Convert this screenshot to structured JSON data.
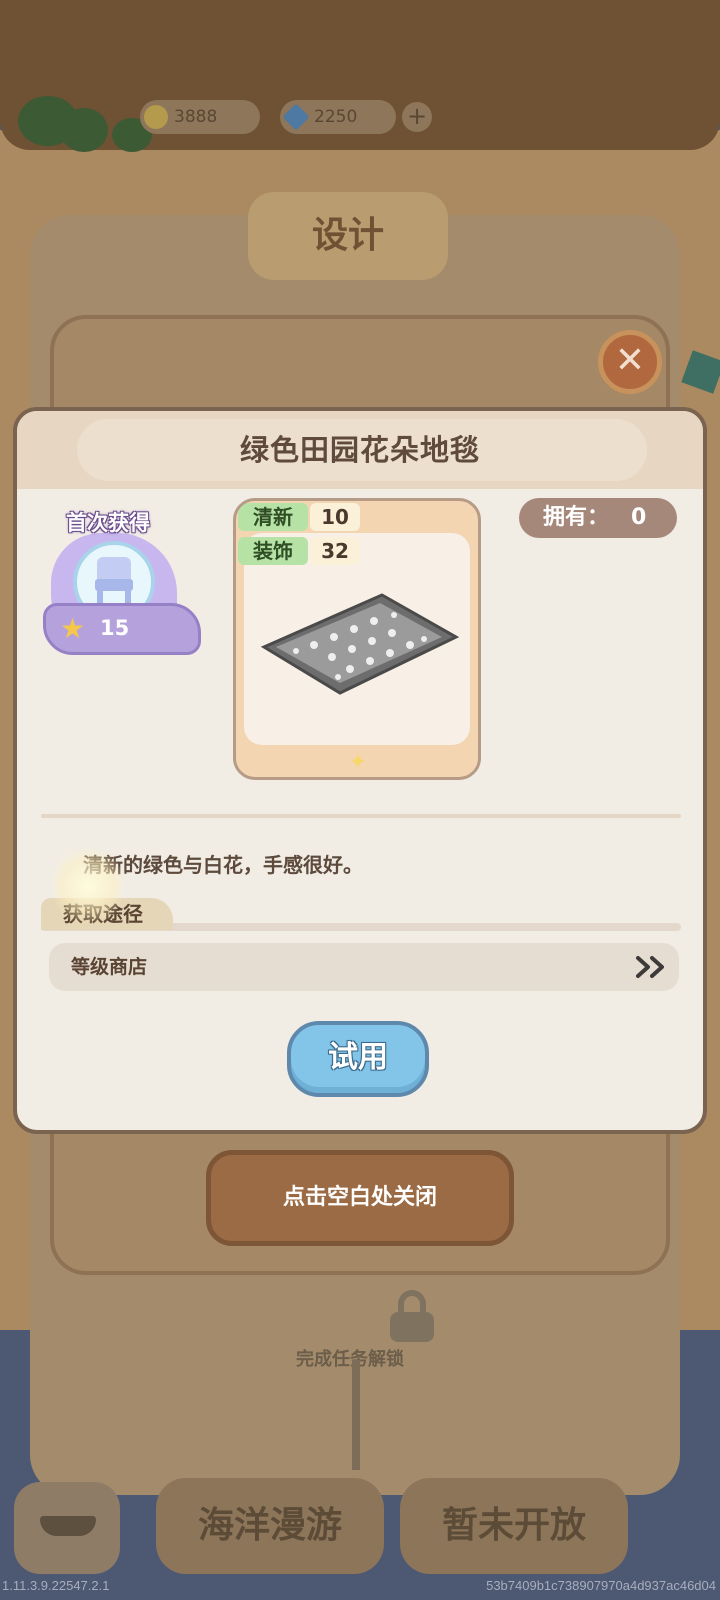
{
  "background": {
    "design_tab_label": "设计",
    "tap_close_label": "点击空白处关闭",
    "locked_hint": "完成任务解锁",
    "bottom_tabs": [
      {
        "label": "海洋漫游"
      },
      {
        "label": "暂未开放"
      }
    ],
    "currency": [
      {
        "icon": "coin-icon",
        "value": "3888"
      },
      {
        "icon": "diamond-icon",
        "value": "2250"
      }
    ]
  },
  "dialog": {
    "title": "绿色田园花朵地毯",
    "first_get": {
      "label": "首次获得",
      "icon": "chair-icon",
      "reward_value": "15"
    },
    "stats": [
      {
        "label": "清新",
        "value": "10"
      },
      {
        "label": "装饰",
        "value": "32"
      }
    ],
    "owned": {
      "label": "拥有：",
      "value": "0"
    },
    "description": "清新的绿色与白花，手感很好。",
    "source": {
      "tab_label": "获取途径",
      "items": [
        {
          "label": "等级商店"
        }
      ]
    },
    "try_label": "试用"
  },
  "footer": {
    "version": "1.11.3.9.22547.2.1",
    "build_hash": "53b7409b1c738907970a4d937ac46d04"
  },
  "colors": {
    "dialog_bg": "#f1ede5",
    "header_bg": "#e7d7c2",
    "try_button": "#83c5e8",
    "stat_label_bg": "#b7e2a6",
    "owned_badge": "#a5887a"
  }
}
